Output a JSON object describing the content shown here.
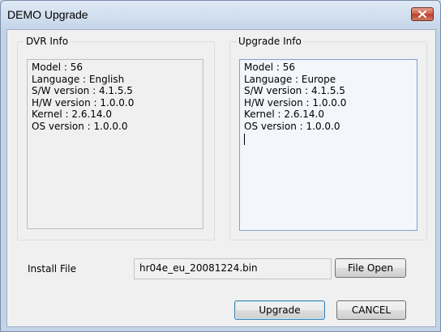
{
  "window": {
    "title": "DEMO Upgrade",
    "close_icon": "close-icon"
  },
  "dvr_info": {
    "label": "DVR Info",
    "lines": [
      "Model : 56",
      "Language : English",
      "S/W version : 4.1.5.5",
      "H/W version : 1.0.0.0",
      "Kernel : 2.6.14.0",
      "OS version : 1.0.0.0"
    ]
  },
  "upgrade_info": {
    "label": "Upgrade Info",
    "lines": [
      "Model : 56",
      "Language : Europe",
      "S/W version : 4.1.5.5",
      "H/W version : 1.0.0.0",
      "Kernel : 2.6.14.0",
      "OS version : 1.0.0.0"
    ]
  },
  "install": {
    "label": "Install File",
    "value": "hr04e_eu_20081224.bin",
    "file_open_label": "File Open"
  },
  "buttons": {
    "upgrade": "Upgrade",
    "cancel": "CANCEL"
  },
  "colors": {
    "close_button": "#c75b45",
    "title_bar": "#c3d4e8",
    "focus_border": "#3c7fb1"
  }
}
